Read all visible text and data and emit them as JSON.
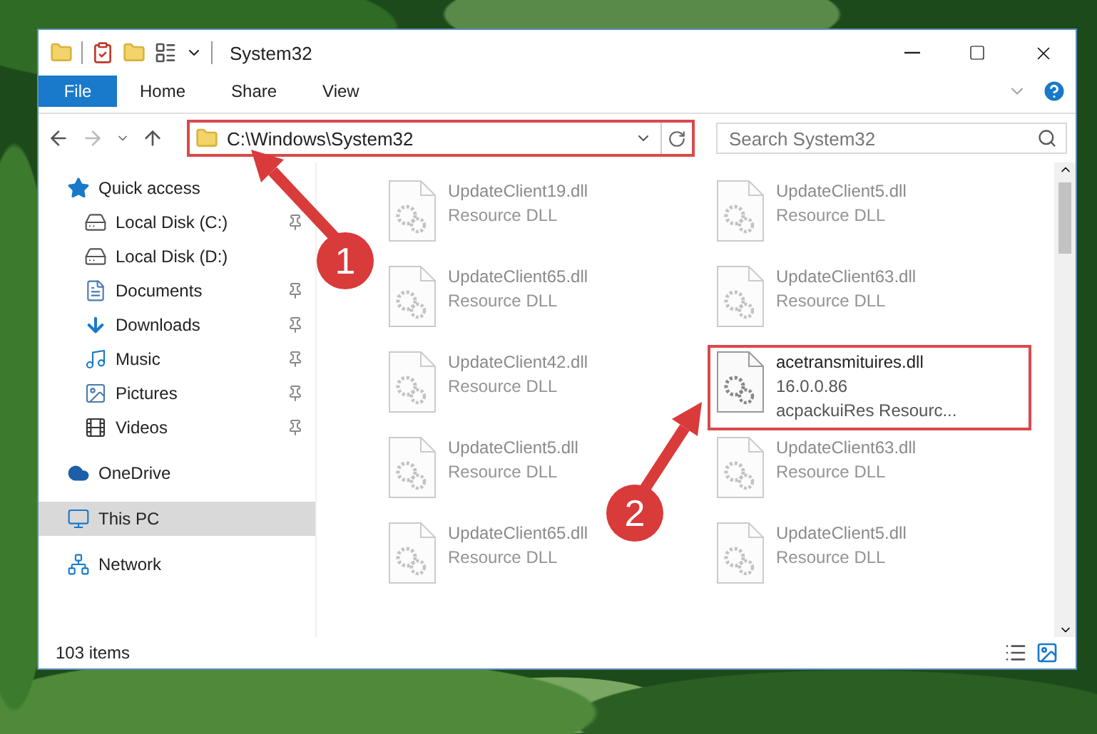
{
  "window": {
    "title": "System32"
  },
  "ribbon_tabs": [
    {
      "label": "File",
      "selected": true
    },
    {
      "label": "Home",
      "selected": false
    },
    {
      "label": "Share",
      "selected": false
    },
    {
      "label": "View",
      "selected": false
    }
  ],
  "address": {
    "path": "C:\\Windows\\System32",
    "highlighted": true
  },
  "search": {
    "placeholder": "Search System32"
  },
  "sidebar": {
    "items": [
      {
        "label": "Quick access",
        "kind": "star",
        "selected": false,
        "children": [
          {
            "label": "Local Disk (C:)",
            "kind": "drive",
            "pinned": true,
            "selected": false
          },
          {
            "label": "Local Disk (D:)",
            "kind": "drive",
            "pinned": false,
            "selected": false
          },
          {
            "label": "Documents",
            "kind": "document",
            "pinned": true,
            "selected": false
          },
          {
            "label": "Downloads",
            "kind": "download",
            "pinned": true,
            "selected": false
          },
          {
            "label": "Music",
            "kind": "music",
            "pinned": true,
            "selected": false
          },
          {
            "label": "Pictures",
            "kind": "pictures",
            "pinned": true,
            "selected": false
          },
          {
            "label": "Videos",
            "kind": "videos",
            "pinned": true,
            "selected": false
          }
        ]
      },
      {
        "label": "OneDrive",
        "kind": "cloud",
        "selected": false
      },
      {
        "label": "This PC",
        "kind": "pc",
        "selected": true
      },
      {
        "label": "Network",
        "kind": "network",
        "selected": false
      }
    ]
  },
  "files": [
    {
      "name": "UpdateClient19.dll",
      "lines": [
        "Resource DLL"
      ],
      "dimmed": true,
      "highlighted": false
    },
    {
      "name": "UpdateClient5.dll",
      "lines": [
        "Resource DLL"
      ],
      "dimmed": true,
      "highlighted": false
    },
    {
      "name": "UpdateClient65.dll",
      "lines": [
        "Resource DLL"
      ],
      "dimmed": true,
      "highlighted": false
    },
    {
      "name": "UpdateClient63.dll",
      "lines": [
        "Resource DLL"
      ],
      "dimmed": true,
      "highlighted": false
    },
    {
      "name": "UpdateClient42.dll",
      "lines": [
        "Resource DLL"
      ],
      "dimmed": true,
      "highlighted": false
    },
    {
      "name": "acetransmituires.dll",
      "lines": [
        "16.0.0.86",
        "acpackuiRes Resourc..."
      ],
      "dimmed": false,
      "highlighted": true
    },
    {
      "name": "UpdateClient5.dll",
      "lines": [
        "Resource DLL"
      ],
      "dimmed": true,
      "highlighted": false
    },
    {
      "name": "UpdateClient63.dll",
      "lines": [
        "Resource DLL"
      ],
      "dimmed": true,
      "highlighted": false
    },
    {
      "name": "UpdateClient65.dll",
      "lines": [
        "Resource DLL"
      ],
      "dimmed": true,
      "highlighted": false
    },
    {
      "name": "UpdateClient5.dll",
      "lines": [
        "Resource DLL"
      ],
      "dimmed": true,
      "highlighted": false
    }
  ],
  "status_bar": {
    "count": "103 items"
  },
  "callouts": [
    {
      "number": "1"
    },
    {
      "number": "2"
    }
  ]
}
